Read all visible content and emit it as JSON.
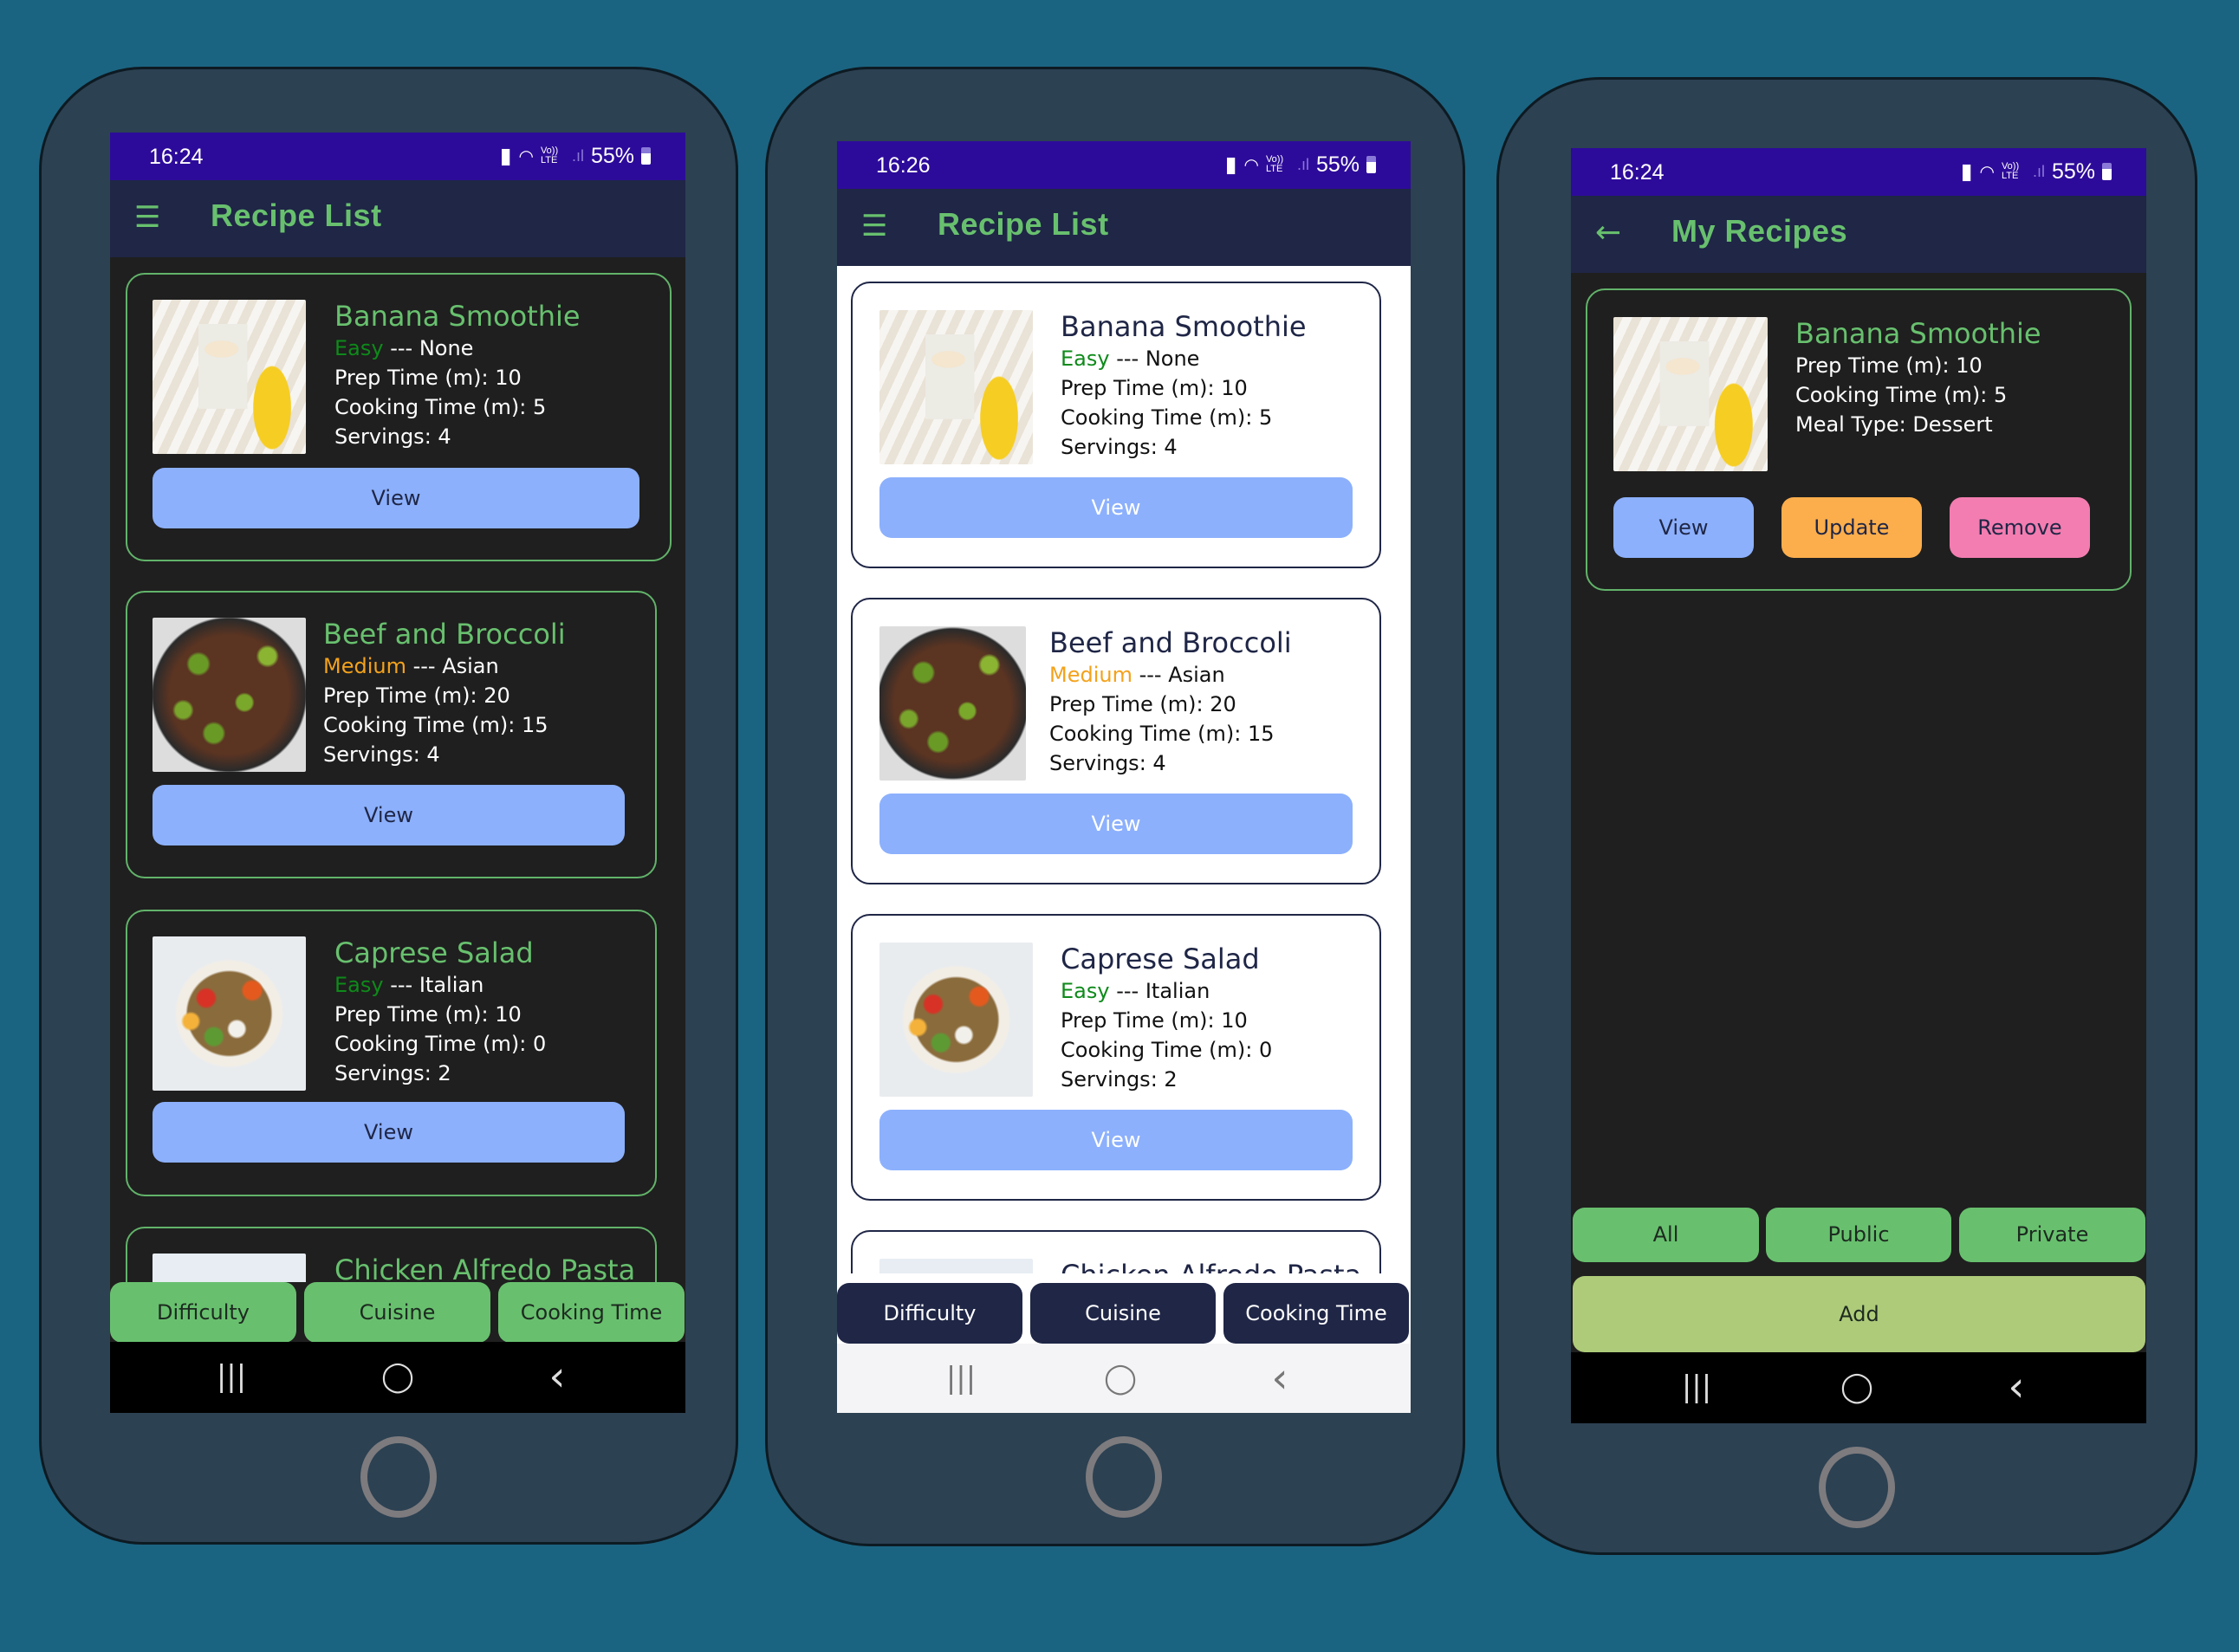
{
  "colors": {
    "background": "#1b6481",
    "phone_body": "#2c4152",
    "status_bar": "#2d0b9a",
    "app_bar": "#1f2646",
    "accent_green": "#68c06e",
    "view_button": "#8cb0fc",
    "update_button": "#fcae4c",
    "remove_button": "#f37db0",
    "add_button": "#adcb79",
    "easy": "#0e8a1a",
    "medium": "#f3a21c"
  },
  "status_icons": [
    "battery-saver-icon",
    "wifi-icon",
    "volte-lte-icon",
    "signal-icon",
    "battery-icon"
  ],
  "phones": [
    {
      "theme": "dark",
      "status": {
        "time": "16:24",
        "battery": "55%",
        "volte": "Vo)) LTE"
      },
      "appbar": {
        "icon": "menu-icon",
        "title": "Recipe List"
      },
      "recipes": [
        {
          "name": "Banana Smoothie",
          "difficulty": "Easy",
          "cuisine": "--- None",
          "prep": "Prep Time (m): 10",
          "cook": "Cooking Time (m): 5",
          "servings": "Servings: 4",
          "button": "View"
        },
        {
          "name": "Beef and Broccoli",
          "difficulty": "Medium",
          "cuisine": "--- Asian",
          "prep": "Prep Time (m): 20",
          "cook": "Cooking Time (m): 15",
          "servings": "Servings: 4",
          "button": "View"
        },
        {
          "name": "Caprese Salad",
          "difficulty": "Easy",
          "cuisine": "--- Italian",
          "prep": "Prep Time (m): 10",
          "cook": "Cooking Time (m): 0",
          "servings": "Servings: 2",
          "button": "View"
        },
        {
          "name": "Chicken Alfredo Pasta"
        }
      ],
      "filters": [
        "Difficulty",
        "Cuisine",
        "Cooking Time"
      ],
      "navbar": {
        "recents": "|||",
        "home": "◯",
        "back": "‹"
      }
    },
    {
      "theme": "light",
      "status": {
        "time": "16:26",
        "battery": "55%",
        "volte": "Vo)) LTE"
      },
      "appbar": {
        "icon": "menu-icon",
        "title": "Recipe List"
      },
      "recipes": [
        {
          "name": "Banana Smoothie",
          "difficulty": "Easy",
          "cuisine": "--- None",
          "prep": "Prep Time (m): 10",
          "cook": "Cooking Time (m): 5",
          "servings": "Servings: 4",
          "button": "View"
        },
        {
          "name": "Beef and Broccoli",
          "difficulty": "Medium",
          "cuisine": "--- Asian",
          "prep": "Prep Time (m): 20",
          "cook": "Cooking Time (m): 15",
          "servings": "Servings: 4",
          "button": "View"
        },
        {
          "name": "Caprese Salad",
          "difficulty": "Easy",
          "cuisine": "--- Italian",
          "prep": "Prep Time (m): 10",
          "cook": "Cooking Time (m): 0",
          "servings": "Servings: 2",
          "button": "View"
        },
        {
          "name": "Chicken Alfredo Pasta"
        }
      ],
      "filters": [
        "Difficulty",
        "Cuisine",
        "Cooking Time"
      ],
      "navbar": {
        "recents": "|||",
        "home": "◯",
        "back": "‹"
      }
    },
    {
      "theme": "dark",
      "status": {
        "time": "16:24",
        "battery": "55%",
        "volte": "Vo)) LTE"
      },
      "appbar": {
        "icon": "back-arrow-icon",
        "title": "My Recipes"
      },
      "recipes": [
        {
          "name": "Banana Smoothie",
          "prep": "Prep Time (m): 10",
          "cook": "Cooking Time (m): 5",
          "meal_type": "Meal Type: Dessert",
          "buttons": [
            "View",
            "Update",
            "Remove"
          ]
        }
      ],
      "filters": [
        "All",
        "Public",
        "Private"
      ],
      "add_button": "Add",
      "navbar": {
        "recents": "|||",
        "home": "◯",
        "back": "‹"
      }
    }
  ]
}
